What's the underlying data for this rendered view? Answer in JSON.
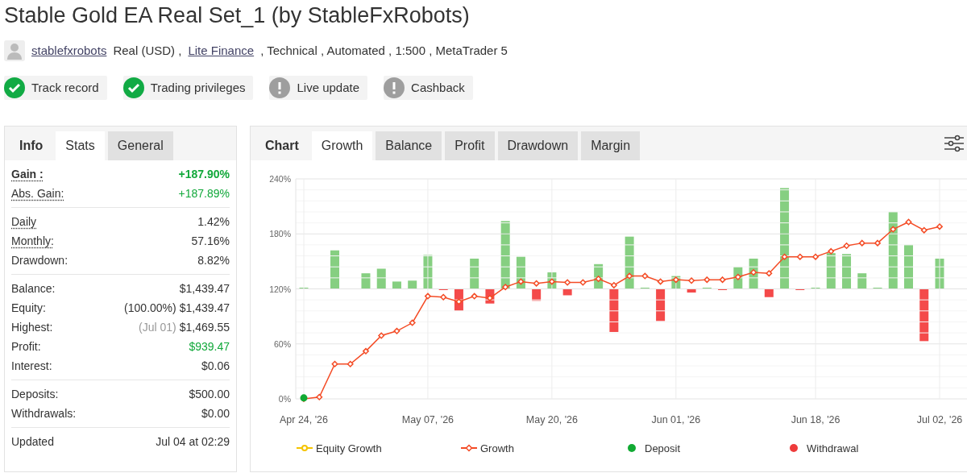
{
  "title": "Stable Gold EA Real Set_1 (by StableFxRobots)",
  "account": {
    "user": "stablefxrobots",
    "parts": [
      {
        "text": "Real (USD) ,",
        "link": false
      },
      {
        "text": "Lite Finance",
        "link": true
      },
      {
        "text": ", Technical , Automated , 1:500 , MetaTrader 5",
        "link": false
      }
    ]
  },
  "badges": [
    {
      "label": "Track record",
      "verified": true
    },
    {
      "label": "Trading privileges",
      "verified": true
    },
    {
      "label": "Live update",
      "verified": false
    },
    {
      "label": "Cashback",
      "verified": false
    }
  ],
  "stats_panel": {
    "tabs": [
      {
        "label": "Info",
        "kind": "heading"
      },
      {
        "label": "Stats",
        "kind": "tab",
        "selected": true
      },
      {
        "label": "General",
        "kind": "tab",
        "selected": false
      }
    ],
    "groups": [
      [
        {
          "label": "Gain :",
          "value": "+187.90%",
          "dotted": true,
          "bold": true,
          "positive": true
        },
        {
          "label": "Abs. Gain:",
          "value": "+187.89%",
          "dotted": true,
          "bold": false,
          "positive": true
        }
      ],
      [
        {
          "label": "Daily",
          "value": "1.42%",
          "dotted": true,
          "bold": false,
          "positive": false
        },
        {
          "label": "Monthly:",
          "value": "57.16%",
          "dotted": true,
          "bold": false,
          "positive": false
        },
        {
          "label": "Drawdown:",
          "value": "8.82%",
          "dotted": false,
          "bold": false,
          "positive": false
        }
      ],
      [
        {
          "label": "Balance:",
          "value": "$1,439.47",
          "dotted": false,
          "bold": false,
          "positive": false
        },
        {
          "label": "Equity:",
          "note": "(100.00%)",
          "note_muted": false,
          "value": "$1,439.47",
          "dotted": false,
          "bold": false,
          "positive": false
        },
        {
          "label": "Highest:",
          "note": "(Jul 01)",
          "note_muted": true,
          "value": "$1,469.55",
          "dotted": false,
          "bold": false,
          "positive": false
        },
        {
          "label": "Profit:",
          "value": "$939.47",
          "dotted": false,
          "bold": false,
          "positive": true
        },
        {
          "label": "Interest:",
          "value": "$0.06",
          "dotted": false,
          "bold": false,
          "positive": false
        }
      ],
      [
        {
          "label": "Deposits:",
          "value": "$500.00",
          "dotted": false,
          "bold": false,
          "positive": false
        },
        {
          "label": "Withdrawals:",
          "value": "$0.00",
          "dotted": false,
          "bold": false,
          "positive": false
        }
      ],
      [
        {
          "label": "Updated",
          "value": "Jul 04 at 02:29",
          "dotted": false,
          "bold": false,
          "positive": false
        }
      ]
    ]
  },
  "chart_panel": {
    "tabs": [
      {
        "label": "Chart",
        "kind": "heading"
      },
      {
        "label": "Growth",
        "kind": "tab",
        "selected": true
      },
      {
        "label": "Balance",
        "kind": "tab",
        "selected": false
      },
      {
        "label": "Profit",
        "kind": "tab",
        "selected": false
      },
      {
        "label": "Drawdown",
        "kind": "tab",
        "selected": false
      },
      {
        "label": "Margin",
        "kind": "tab",
        "selected": false
      }
    ],
    "chart_data": {
      "type": "line",
      "grid": true,
      "legend": true,
      "categories": [
        "Apr 24, '26",
        null,
        null,
        null,
        null,
        null,
        null,
        null,
        "May 07, '26",
        null,
        null,
        null,
        null,
        null,
        null,
        null,
        "May 20, '26",
        null,
        null,
        null,
        null,
        null,
        null,
        null,
        "Jun 01, '26",
        null,
        null,
        null,
        null,
        null,
        null,
        null,
        null,
        "Jun 18, '26",
        null,
        null,
        null,
        null,
        null,
        null,
        null,
        "Jul 02, '26"
      ],
      "yticks": [
        {
          "value": 0,
          "label": "0%"
        },
        {
          "value": 60,
          "label": "60%"
        },
        {
          "value": 120,
          "label": "120%"
        },
        {
          "value": 180,
          "label": "180%"
        },
        {
          "value": 240,
          "label": "240%"
        }
      ],
      "ylim": [
        0,
        240
      ],
      "series": [
        {
          "name": "Equity Growth",
          "marker": "circle",
          "color": "#f5c400",
          "values": [
            null,
            null,
            null,
            null,
            null,
            null,
            null,
            null,
            null,
            null,
            null,
            null,
            null,
            null,
            null,
            null,
            null,
            null,
            null,
            null,
            null,
            null,
            null,
            null,
            null,
            null,
            null,
            null,
            null,
            null,
            null,
            null,
            null,
            null,
            null,
            null,
            null,
            null,
            null,
            null,
            null,
            null
          ]
        },
        {
          "name": "Growth",
          "marker": "diamond",
          "color": "#f44b25",
          "values": [
            0,
            2,
            38,
            38,
            52,
            69,
            74,
            83,
            112,
            111,
            106,
            112,
            110,
            122,
            128,
            126,
            128,
            127,
            127,
            131,
            124,
            134,
            134,
            128,
            130,
            129,
            130,
            130,
            133,
            138,
            137,
            155,
            155,
            155,
            161,
            167,
            170,
            170,
            185,
            193,
            184,
            188
          ]
        },
        {
          "name": "Deposit",
          "type": "scatter",
          "marker": "circle",
          "color": "#11aa33",
          "values": [
            1,
            null,
            null,
            null,
            null,
            null,
            null,
            null,
            null,
            null,
            null,
            null,
            null,
            null,
            null,
            null,
            null,
            null,
            null,
            null,
            null,
            null,
            null,
            null,
            null,
            null,
            null,
            null,
            null,
            null,
            null,
            null,
            null,
            null,
            null,
            null,
            null,
            null,
            null,
            null,
            null,
            null
          ]
        },
        {
          "name": "Withdrawal",
          "type": "scatter",
          "marker": "circle",
          "color": "#ee3b3b",
          "values": [
            null,
            null,
            null,
            null,
            null,
            null,
            null,
            null,
            null,
            null,
            null,
            null,
            null,
            null,
            null,
            null,
            null,
            null,
            null,
            null,
            null,
            null,
            null,
            null,
            null,
            null,
            null,
            null,
            null,
            null,
            null,
            null,
            null,
            null,
            null,
            null,
            null,
            null,
            null,
            null,
            null,
            null
          ]
        }
      ]
    }
  }
}
